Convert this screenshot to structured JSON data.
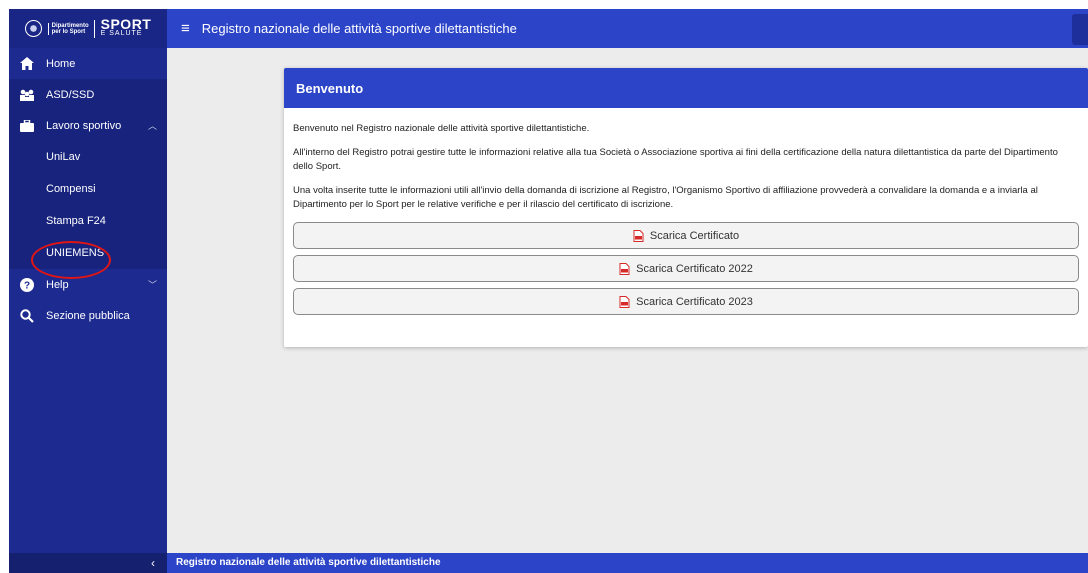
{
  "logo": {
    "dept_text": "Dipartimento\nper lo Sport",
    "sport_big": "SPORT",
    "sport_small": "E SALUTE"
  },
  "sidebar": {
    "items": [
      {
        "label": "Home",
        "icon": "home-icon"
      },
      {
        "label": "ASD/SSD",
        "icon": "users-icon"
      },
      {
        "label": "Lavoro sportivo",
        "icon": "briefcase-icon",
        "expanded": true
      },
      {
        "label": "Help",
        "icon": "help-icon"
      },
      {
        "label": "Sezione pubblica",
        "icon": "search-icon"
      }
    ],
    "sub_items": [
      {
        "label": "UniLav"
      },
      {
        "label": "Compensi"
      },
      {
        "label": "Stampa F24"
      },
      {
        "label": "UNIEMENS",
        "highlighted": true
      }
    ],
    "collapse_glyph": "‹"
  },
  "header": {
    "title": "Registro nazionale delle attività sportive dilettantistiche",
    "menu_glyph": "≡"
  },
  "card": {
    "title": "Benvenuto",
    "paragraphs": [
      "Benvenuto nel Registro nazionale delle attività sportive dilettantistiche.",
      "All'interno del Registro potrai gestire tutte le informazioni relative alla tua Società o Associazione sportiva ai fini della certificazione della natura dilettantistica da parte del Dipartimento dello Sport.",
      "Una volta inserite tutte le informazioni utili all'invio della domanda di iscrizione al Registro, l'Organismo Sportivo di affiliazione provvederà a convalidare la domanda e a inviarla al Dipartimento per lo Sport per le relative verifiche e per il rilascio del certificato di iscrizione."
    ],
    "buttons": [
      {
        "label": "Scarica Certificato"
      },
      {
        "label": "Scarica Certificato 2022"
      },
      {
        "label": "Scarica Certificato 2023"
      }
    ]
  },
  "footer": {
    "text": "Registro nazionale delle attività sportive dilettantistiche"
  },
  "colors": {
    "sidebar": "#1d2a8f",
    "header": "#2c44c8",
    "highlight_circle": "#e01515",
    "pdf_icon": "#d62a2a"
  }
}
